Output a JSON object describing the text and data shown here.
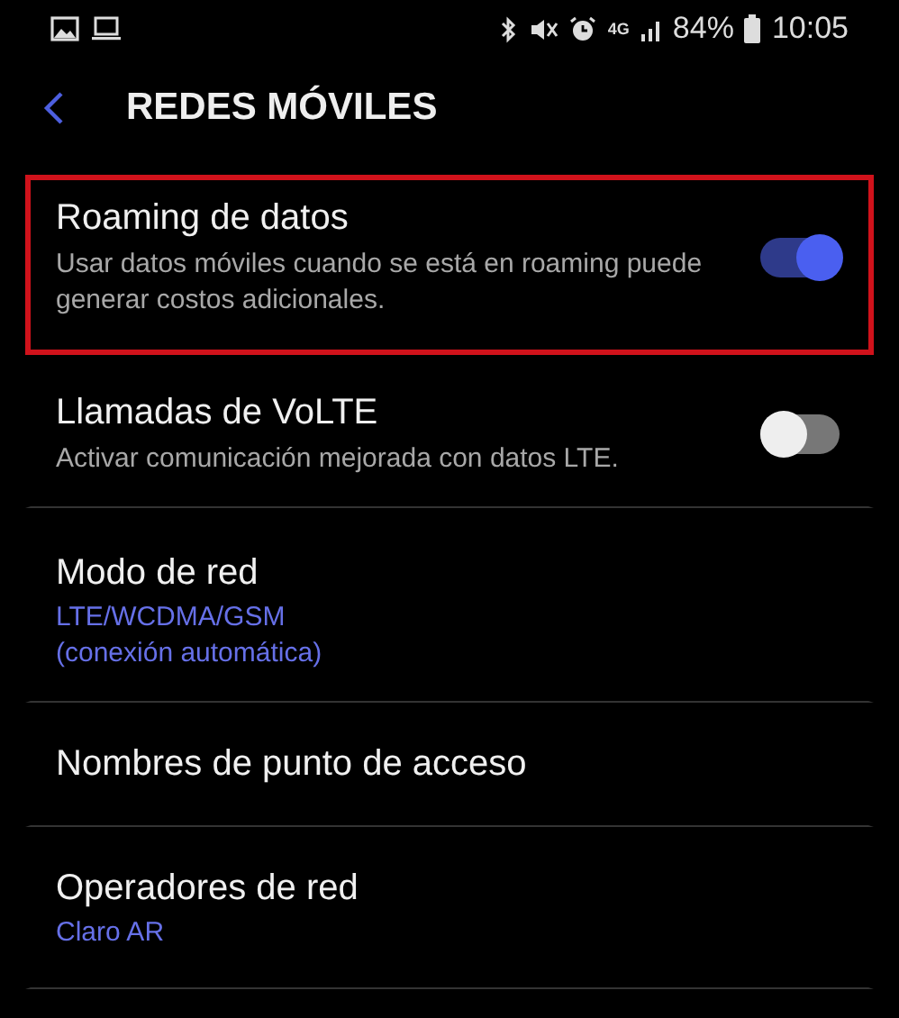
{
  "status_bar": {
    "signal_label": "4G",
    "battery": "84%",
    "time": "10:05"
  },
  "header": {
    "title": "REDES MÓVILES"
  },
  "items": [
    {
      "kind": "toggle",
      "title": "Roaming de datos",
      "summary": "Usar datos móviles cuando se está en roaming puede generar costos adicionales.",
      "on": true,
      "highlighted": true
    },
    {
      "kind": "toggle",
      "title": "Llamadas de VoLTE",
      "summary": "Activar comunicación mejorada con datos LTE.",
      "on": false,
      "highlighted": false
    },
    {
      "kind": "link",
      "title": "Modo de red",
      "values": [
        "LTE/WCDMA/GSM",
        "(conexión automática)"
      ],
      "highlighted": false
    },
    {
      "kind": "link",
      "title": "Nombres de punto de acceso",
      "highlighted": false
    },
    {
      "kind": "link",
      "title": "Operadores de red",
      "values": [
        "Claro AR"
      ],
      "highlighted": false
    }
  ]
}
